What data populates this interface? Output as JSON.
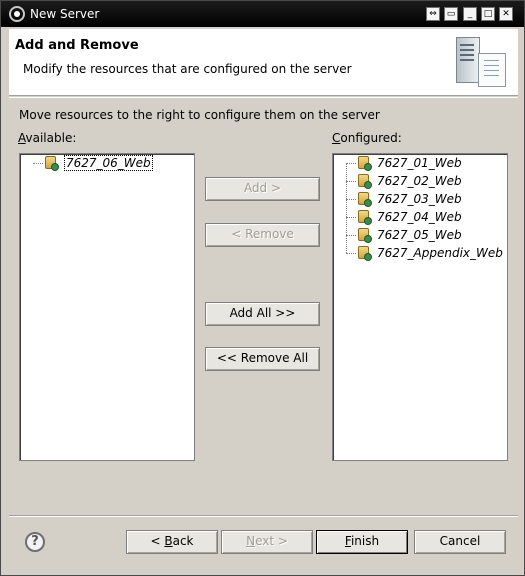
{
  "window": {
    "title": "New Server"
  },
  "header": {
    "title": "Add and Remove",
    "subtitle": "Modify the resources that are configured on the server"
  },
  "instructions": "Move resources to the right to configure them on the server",
  "available": {
    "label_hot": "A",
    "label_rest": "vailable:",
    "items": [
      "7627_06_Web"
    ],
    "selected": "7627_06_Web"
  },
  "configured": {
    "label_hot": "C",
    "label_rest": "onfigured:",
    "items": [
      "7627_01_Web",
      "7627_02_Web",
      "7627_03_Web",
      "7627_04_Web",
      "7627_05_Web",
      "7627_Appendix_Web"
    ]
  },
  "buttons": {
    "add": "Add >",
    "remove": "< Remove",
    "add_all": "Add All >>",
    "remove_all": "<< Remove All",
    "back_pre": "< ",
    "back_hot": "B",
    "back_rest": "ack",
    "next_hot": "N",
    "next_rest": "ext >",
    "finish_hot": "F",
    "finish_rest": "inish",
    "cancel": "Cancel"
  },
  "help": {
    "glyph": "?"
  },
  "titlebar_glyphs": {
    "pin": "⇔",
    "restore": "▭",
    "minimize": "_",
    "maximize": "□",
    "close": "✕"
  }
}
